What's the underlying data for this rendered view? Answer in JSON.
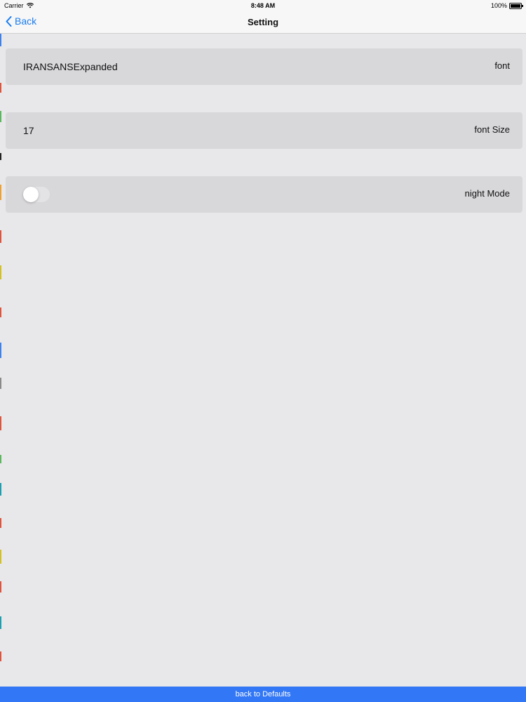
{
  "status_bar": {
    "carrier": "Carrier",
    "time": "8:48 AM",
    "battery": "100%"
  },
  "nav": {
    "back_label": "Back",
    "title": "Setting"
  },
  "settings": {
    "font": {
      "label": "font",
      "value": "IRANSANSExpanded"
    },
    "font_size": {
      "label": "font Size",
      "value": "17"
    },
    "night_mode": {
      "label": "night Mode",
      "enabled": false
    }
  },
  "footer": {
    "button_label": "back to Defaults"
  },
  "colors": {
    "accent": "#1a7cf0",
    "footer_bg": "#3277f5",
    "background": "#e8e7e9",
    "row_bg": "#d8d7da"
  }
}
